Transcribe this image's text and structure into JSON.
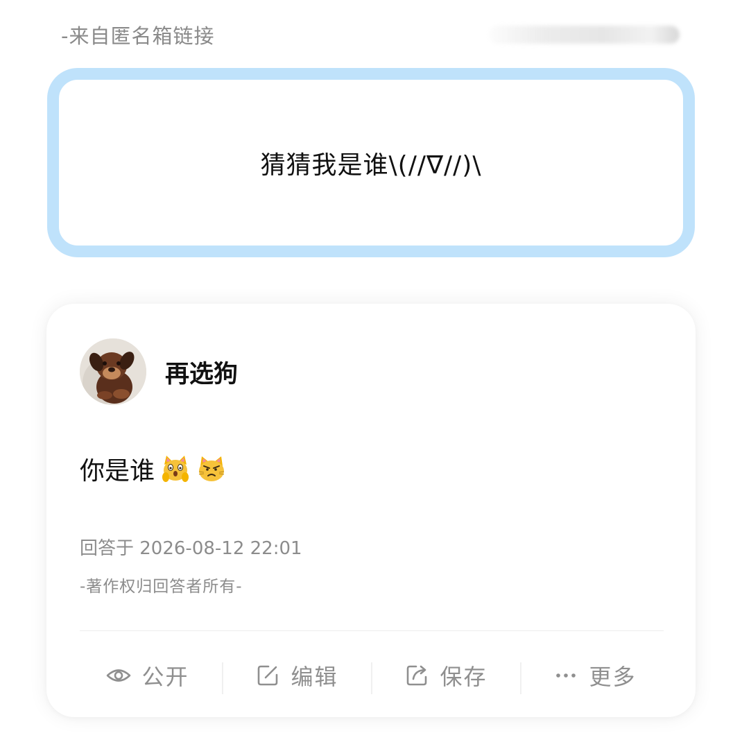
{
  "source": {
    "label": "-来自匿名箱链接"
  },
  "question": {
    "text": "猜猜我是谁\\(//∇//)\\"
  },
  "answer": {
    "author_name": "再选狗",
    "text": "你是谁",
    "emojis": [
      "scared-cat-emoji",
      "pouting-cat-emoji"
    ],
    "time": "回答于 2026-08-12 22:01",
    "copyright": "-著作权归回答者所有-"
  },
  "actions": {
    "public": "公开",
    "edit": "编辑",
    "save": "保存",
    "more": "更多"
  },
  "colors": {
    "question_border": "#bfe2fb",
    "muted_text": "#8c8c8c",
    "primary_text": "#111111"
  }
}
